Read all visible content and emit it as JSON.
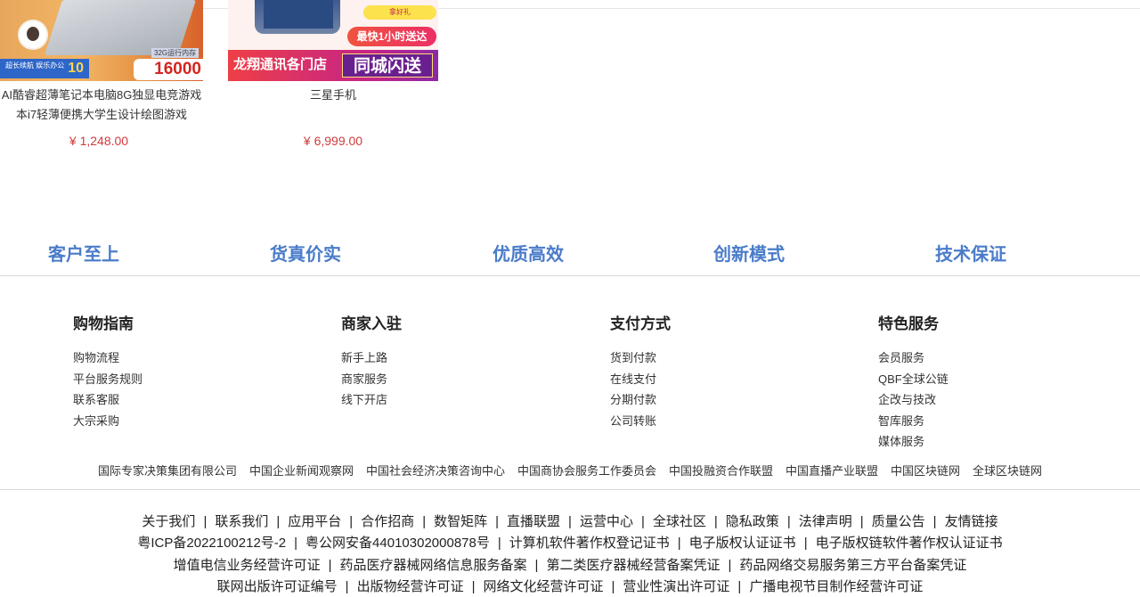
{
  "products": [
    {
      "title_line1": "AI酷睿超薄笔记本电脑8G独显电竞游戏",
      "title_line2": "本i7轻薄便携大学生设计绘图游戏",
      "price": "¥ 1,248.00",
      "banner": {
        "ten_small": "超长续航 娱乐办公",
        "ten": "10",
        "spec": "32G运行内存",
        "price_tag": "16000"
      }
    },
    {
      "title_line1": "三星手机",
      "price": "¥ 6,999.00",
      "banner": {
        "badge": "拿好礼",
        "fast": "最快1小时送达",
        "store": "龙翔通讯各门店",
        "city": "同城闪送"
      }
    }
  ],
  "values": [
    "客户至上",
    "货真价实",
    "优质高效",
    "创新模式",
    "技术保证"
  ],
  "footer_columns": [
    {
      "title": "购物指南",
      "items": [
        "购物流程",
        "平台服务规则",
        "联系客服",
        "大宗采购"
      ]
    },
    {
      "title": "商家入驻",
      "items": [
        "新手上路",
        "商家服务",
        "线下开店"
      ]
    },
    {
      "title": "支付方式",
      "items": [
        "货到付款",
        "在线支付",
        "分期付款",
        "公司转账"
      ]
    },
    {
      "title": "特色服务",
      "items": [
        "会员服务",
        "QBF全球公链",
        "企改与技改",
        "智库服务",
        "媒体服务"
      ]
    }
  ],
  "friend_links": [
    "国际专家决策集团有限公司",
    "中国企业新闻观察网",
    "中国社会经济决策咨询中心",
    "中国商协会服务工作委员会",
    "中国投融资合作联盟",
    "中国直播产业联盟",
    "中国区块链网",
    "全球区块链网"
  ],
  "bottom_lines": {
    "line1": [
      "关于我们",
      "联系我们",
      "应用平台",
      "合作招商",
      "数智矩阵",
      "直播联盟",
      "运营中心",
      "全球社区",
      "隐私政策",
      "法律声明",
      "质量公告",
      "友情链接"
    ],
    "line2": [
      "粤ICP备2022100212号-2",
      "粤公网安备44010302000878号",
      "计算机软件著作权登记证书",
      "电子版权认证证书",
      "电子版权链软件著作权认证证书"
    ],
    "line3": [
      "增值电信业务经营许可证",
      "药品医疗器械网络信息服务备案",
      "第二类医疗器械经营备案凭证",
      "药品网络交易服务第三方平台备案凭证"
    ],
    "line4": [
      "联网出版许可证编号",
      "出版物经营许可证",
      "网络文化经营许可证",
      "营业性演出许可证",
      "广播电视节目制作经营许可证"
    ]
  },
  "separator": "|"
}
